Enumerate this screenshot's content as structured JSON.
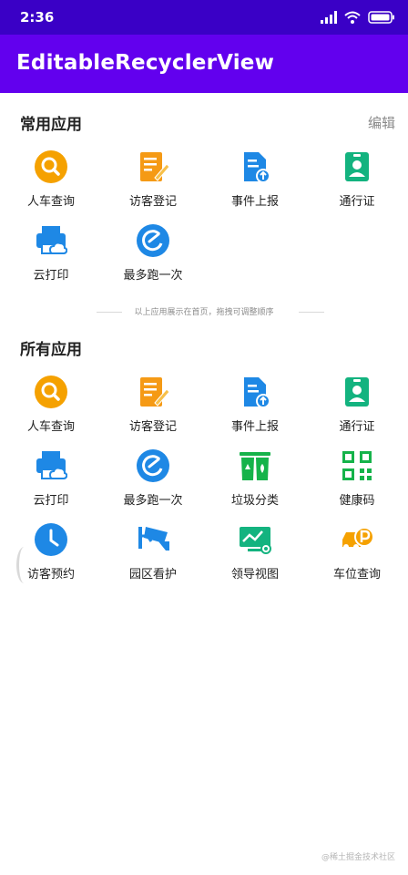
{
  "status_bar": {
    "time": "2:36"
  },
  "app_bar": {
    "title": "EditableRecyclerView"
  },
  "common_section": {
    "title": "常用应用",
    "edit_label": "编辑",
    "items": [
      {
        "label": "人车查询",
        "icon": "search-icon",
        "color": "#f5a100"
      },
      {
        "label": "访客登记",
        "icon": "form-edit-icon",
        "color": "#f59a15"
      },
      {
        "label": "事件上报",
        "icon": "document-upload-icon",
        "color": "#1e88e5"
      },
      {
        "label": "通行证",
        "icon": "badge-id-icon",
        "color": "#13b37f"
      },
      {
        "label": "云打印",
        "icon": "cloud-printer-icon",
        "color": "#1e88e5"
      },
      {
        "label": "最多跑一次",
        "icon": "refresh-circle-icon",
        "color": "#1e88e5"
      }
    ]
  },
  "divider_text": "以上应用展示在首页，拖拽可调整顺序",
  "all_section": {
    "title": "所有应用",
    "items": [
      {
        "label": "人车查询",
        "icon": "search-icon",
        "color": "#f5a100"
      },
      {
        "label": "访客登记",
        "icon": "form-edit-icon",
        "color": "#f59a15"
      },
      {
        "label": "事件上报",
        "icon": "document-upload-icon",
        "color": "#1e88e5"
      },
      {
        "label": "通行证",
        "icon": "badge-id-icon",
        "color": "#13b37f"
      },
      {
        "label": "云打印",
        "icon": "cloud-printer-icon",
        "color": "#1e88e5"
      },
      {
        "label": "最多跑一次",
        "icon": "refresh-circle-icon",
        "color": "#1e88e5"
      },
      {
        "label": "垃圾分类",
        "icon": "trash-bins-icon",
        "color": "#15b34a"
      },
      {
        "label": "健康码",
        "icon": "qr-code-icon",
        "color": "#15b34a"
      },
      {
        "label": "访客预约",
        "icon": "clock-icon",
        "color": "#1e88e5"
      },
      {
        "label": "园区看护",
        "icon": "security-camera-icon",
        "color": "#1e88e5"
      },
      {
        "label": "领导视图",
        "icon": "monitor-chart-icon",
        "color": "#13b37f"
      },
      {
        "label": "车位查询",
        "icon": "parking-car-icon",
        "color": "#f5a100"
      }
    ]
  },
  "watermark": "@稀土掘金技术社区",
  "colors": {
    "status_bar": "#3a00c6",
    "app_bar": "#6200ee"
  }
}
